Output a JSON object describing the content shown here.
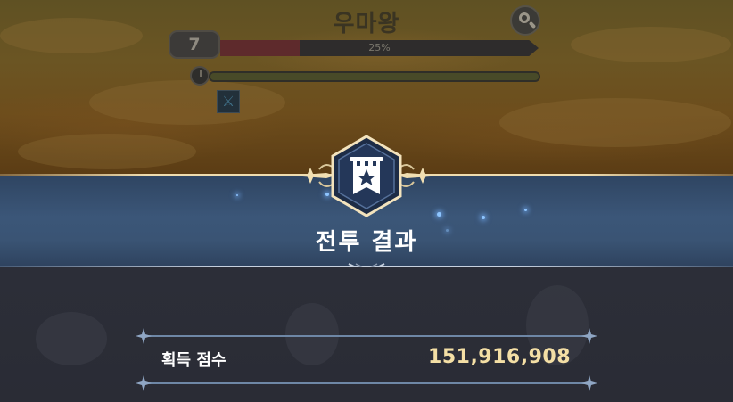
{
  "hud": {
    "boss_name": "우마왕",
    "level": "7",
    "hp_percent_text": "25%",
    "hp_fraction": 0.25,
    "timer_fraction": 1.0
  },
  "result": {
    "title": "전투 결과",
    "score_label": "획득 점수",
    "score_value": "151,916,908"
  },
  "icons": {
    "search": "magnifier-icon",
    "timer": "clock-icon",
    "debuff": "crossed-swords-icon",
    "emblem": "banner-star-icon"
  },
  "colors": {
    "banner": "#3b5678",
    "score_value": "#f4dfa5",
    "gold_line": "#efdcae"
  }
}
